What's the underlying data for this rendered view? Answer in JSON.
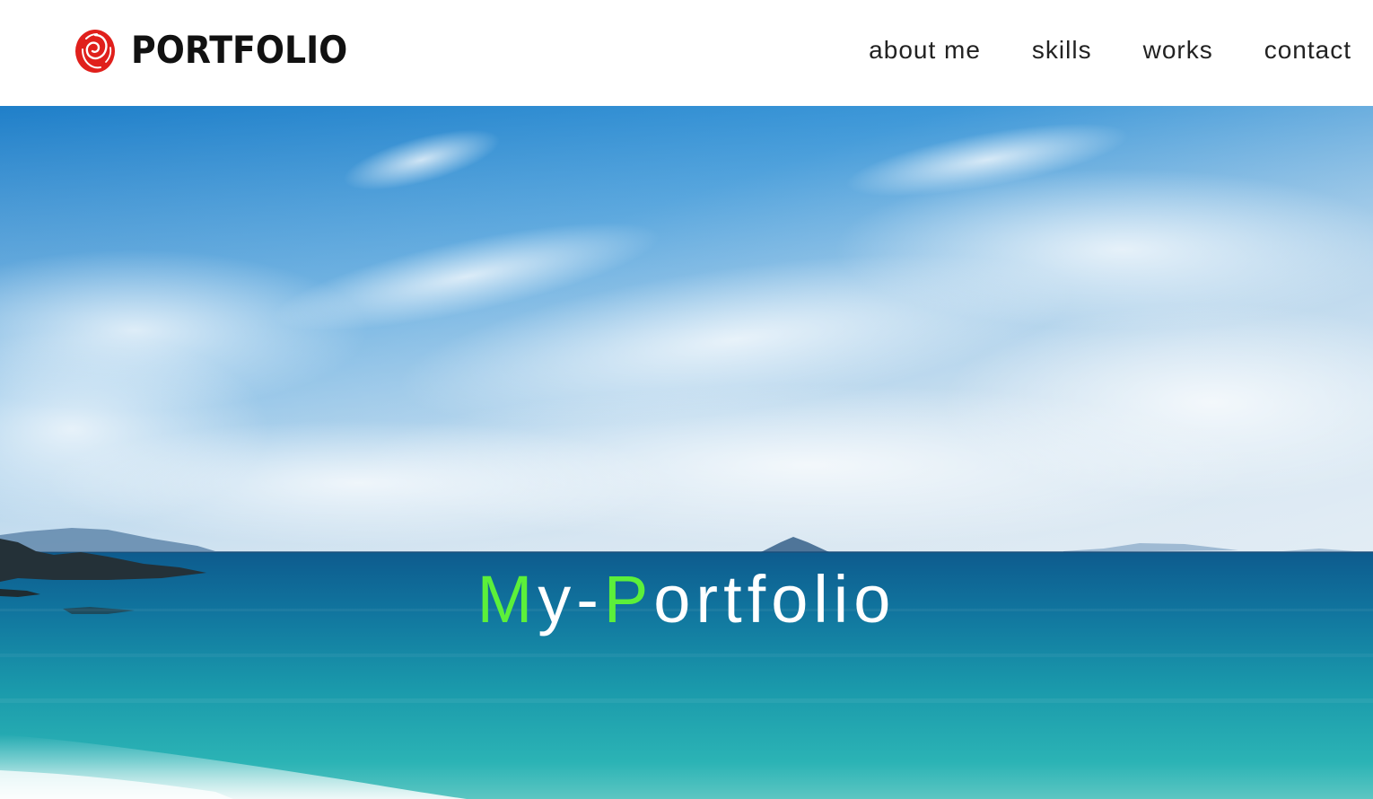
{
  "header": {
    "logo_text": "PORTFOLIO",
    "logo_icon": "rose-icon",
    "logo_color": "#e0201c"
  },
  "nav": {
    "items": [
      {
        "label": "about me"
      },
      {
        "label": "skills"
      },
      {
        "label": "works"
      },
      {
        "label": "contact"
      }
    ]
  },
  "hero": {
    "title_parts": [
      "M",
      "y-",
      "P",
      "ortfolio"
    ],
    "accent_color": "#5cf03a",
    "text_color": "#ffffff"
  }
}
